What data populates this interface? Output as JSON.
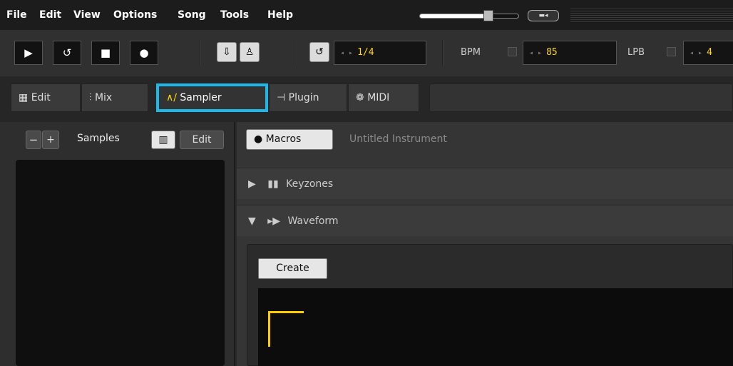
{
  "menu": [
    "File",
    "Edit",
    "View",
    "Options",
    "Song",
    "Tools",
    "Help"
  ],
  "transport": {
    "play_icon": "play-icon",
    "loop_icon": "loop-icon",
    "stop_icon": "stop-icon",
    "record_icon": "record-icon",
    "step": "1/4",
    "bpm_label": "BPM",
    "bpm_value": "85",
    "lpb_label": "LPB",
    "lpb_value": "4"
  },
  "tabs": {
    "edit": "Edit",
    "mix": "Mix",
    "sampler": "Sampler",
    "plugin": "Plugin",
    "midi": "MIDI"
  },
  "samples_panel": {
    "remove": "−",
    "add": "+",
    "label": "Samples",
    "edit": "Edit"
  },
  "instrument": {
    "macros": "Macros",
    "name": "Untitled Instrument"
  },
  "sections": {
    "keyzones": "Keyzones",
    "waveform": "Waveform"
  },
  "waveform": {
    "create": "Create"
  },
  "colors": {
    "accent_tab": "#1fb7e6",
    "value_yellow": "#ffd700",
    "marker": "#ffcc00"
  }
}
